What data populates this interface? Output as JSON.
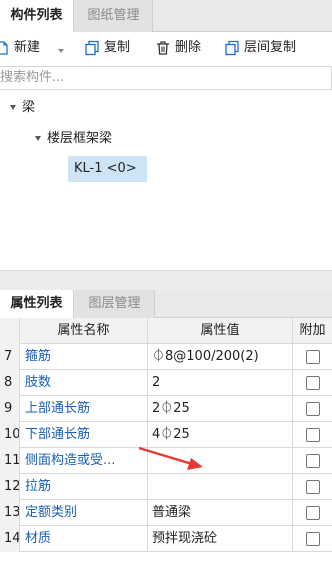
{
  "top_tabs": [
    {
      "label": "构件列表",
      "active": true
    },
    {
      "label": "图纸管理",
      "active": false
    }
  ],
  "toolbar": {
    "new_label": "新建",
    "copy_label": "复制",
    "delete_label": "删除",
    "floor_copy_label": "层间复制",
    "icons": [
      "new-icon",
      "copy-icon",
      "delete-icon",
      "floor-copy-icon"
    ],
    "accent_color": "#1a6fd1"
  },
  "search": {
    "placeholder": "搜索构件..."
  },
  "tree": {
    "root": "梁",
    "child": "楼层框架梁",
    "selected": "KL-1 <0>"
  },
  "bottom_tabs": [
    {
      "label": "属性列表",
      "active": true
    },
    {
      "label": "图层管理",
      "active": false
    }
  ],
  "grid": {
    "headers": {
      "name": "属性名称",
      "value": "属性值",
      "extra": "附加"
    },
    "rows": [
      {
        "num": "7",
        "name": "箍筋",
        "value": "⏀8@100/200(2)"
      },
      {
        "num": "8",
        "name": "肢数",
        "value": "2"
      },
      {
        "num": "9",
        "name": "上部通长筋",
        "value": "2⏀25"
      },
      {
        "num": "10",
        "name": "下部通长筋",
        "value": "4⏀25"
      },
      {
        "num": "11",
        "name": "侧面构造或受...",
        "value": ""
      },
      {
        "num": "12",
        "name": "拉筋",
        "value": ""
      },
      {
        "num": "13",
        "name": "定额类别",
        "value": "普通梁"
      },
      {
        "num": "14",
        "name": "材质",
        "value": "预拌现浇砼"
      }
    ],
    "name_color": "#1a5fb4",
    "annotation_arrow_color": "#e53935"
  }
}
